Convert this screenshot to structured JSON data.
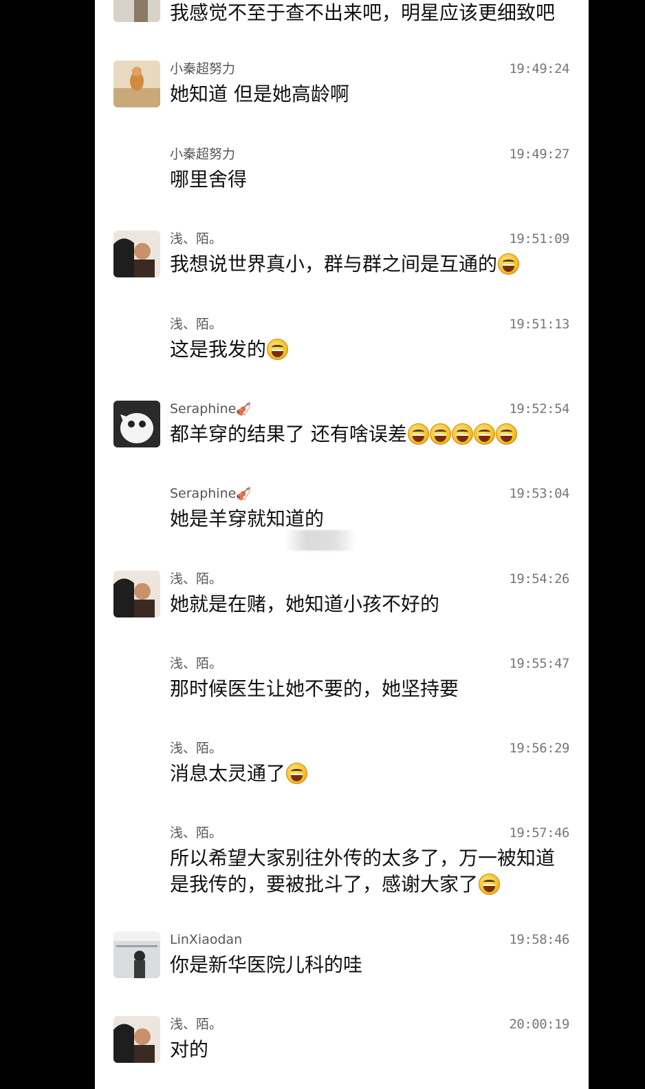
{
  "messages": [
    {
      "name": "",
      "time": "",
      "text": "我感觉不至于查不出来吧，明星应该更细致吧",
      "emoji_count": 0
    },
    {
      "name": "小秦超努力",
      "time": "19:49:24",
      "text": "她知道 但是她高龄啊",
      "emoji_count": 0
    },
    {
      "name": "小秦超努力",
      "time": "19:49:27",
      "text": "哪里舍得",
      "emoji_count": 0
    },
    {
      "name": "浅、陌。",
      "time": "19:51:09",
      "text": "我想说世界真小，群与群之间是互通的",
      "emoji_count": 1
    },
    {
      "name": "浅、陌。",
      "time": "19:51:13",
      "text": "这是我发的",
      "emoji_count": 1
    },
    {
      "name": "Seraphine",
      "time": "19:52:54",
      "text": "都羊穿的结果了 还有啥误差",
      "emoji_count": 5
    },
    {
      "name": "Seraphine",
      "time": "19:53:04",
      "text": "她是羊穿就知道的",
      "emoji_count": 0
    },
    {
      "name": "浅、陌。",
      "time": "19:54:26",
      "text": "她就是在赌，她知道小孩不好的",
      "emoji_count": 0
    },
    {
      "name": "浅、陌。",
      "time": "19:55:47",
      "text": "那时候医生让她不要的，她坚持要",
      "emoji_count": 0
    },
    {
      "name": "浅、陌。",
      "time": "19:56:29",
      "text": "消息太灵通了",
      "emoji_count": 1
    },
    {
      "name": "浅、陌。",
      "time": "19:57:46",
      "text": "所以希望大家别往外传的太多了，万一被知道是我传的，要被批斗了，感谢大家了",
      "emoji_count": 1
    },
    {
      "name": "LinXiaodan",
      "time": "19:58:46",
      "text": "你是新华医院儿科的哇",
      "emoji_count": 0
    },
    {
      "name": "浅、陌。",
      "time": "20:00:19",
      "text": "对的",
      "emoji_count": 0
    }
  ],
  "icons": {
    "name_decoration": "violin-icon",
    "emoji": "laughing-tears-emoji"
  }
}
